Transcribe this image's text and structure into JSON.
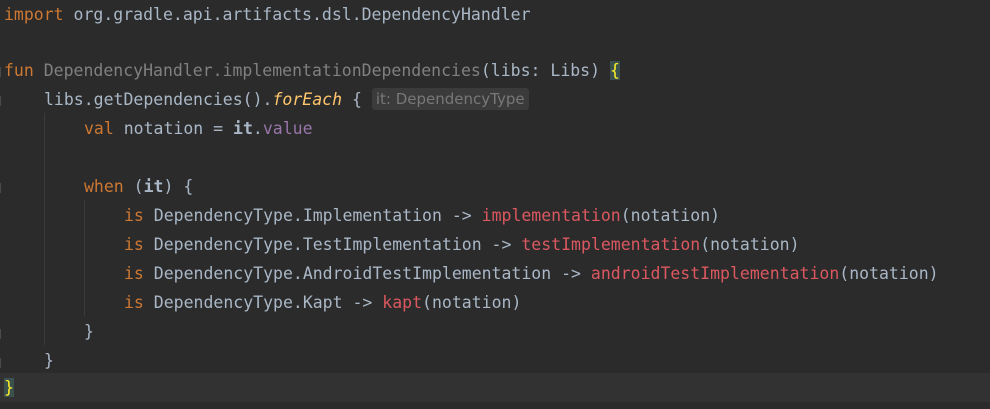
{
  "editor": {
    "language": "Kotlin",
    "lines": {
      "l1": {
        "kw": "import",
        "rest": " org.gradle.api.artifacts.dsl.DependencyHandler"
      },
      "l3": {
        "kw": "fun",
        "receiver": "DependencyHandler.implementationDependencies",
        "params": "(libs: Libs) ",
        "brace": "{"
      },
      "l4": {
        "prefix": "libs.getDependencies().",
        "call": "forEach",
        "brace": " {",
        "hint": "it: DependencyType"
      },
      "l5": {
        "kw": "val",
        "mid": " notation = ",
        "it": "it",
        "dot": ".",
        "prop": "value"
      },
      "l7": {
        "kw": "when",
        "open": " (",
        "it": "it",
        "close": ") {"
      },
      "l8": {
        "kw": "is",
        "type": " DependencyType.Implementation -> ",
        "call": "implementation",
        "args": "(notation)"
      },
      "l9": {
        "kw": "is",
        "type": " DependencyType.TestImplementation -> ",
        "call": "testImplementation",
        "args": "(notation)"
      },
      "l10": {
        "kw": "is",
        "type": " DependencyType.AndroidTestImplementation -> ",
        "call": "androidTestImplementation",
        "args": "(notation)"
      },
      "l11": {
        "kw": "is",
        "type": " DependencyType.Kapt -> ",
        "call": "kapt",
        "args": "(notation)"
      },
      "l12": {
        "text": "}"
      },
      "l13": {
        "text": "}"
      },
      "l14": {
        "text": "}"
      }
    }
  }
}
